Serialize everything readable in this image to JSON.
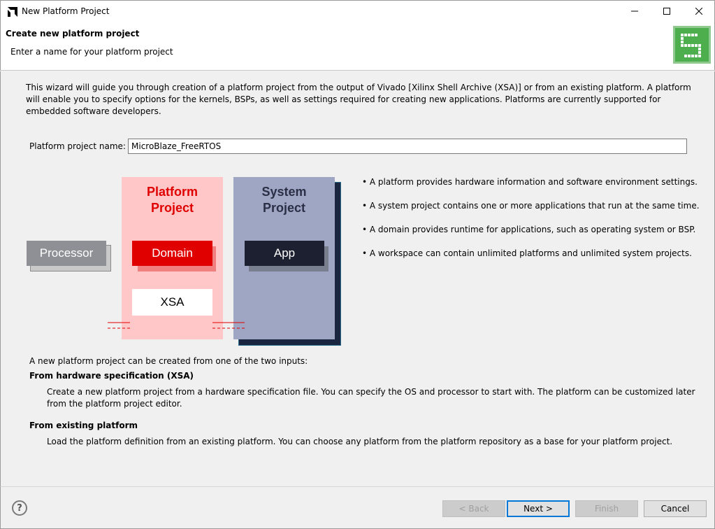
{
  "window": {
    "title": "New Platform Project",
    "icon": "amd-arrow-icon"
  },
  "header": {
    "title": "Create new platform project",
    "subtitle": "Enter a name for your platform project",
    "image_icon": "wizard-banner-icon"
  },
  "intro": "This wizard will guide you through creation of a platform project from the output of Vivado [Xilinx Shell Archive (XSA)] or from an existing platform. A platform will enable you to specify options for the kernels, BSPs, as well as settings required for creating new applications. Platforms are currently supported for embedded software developers.",
  "form": {
    "name_label": "Platform project name:",
    "name_value": "MicroBlaze_FreeRTOS"
  },
  "diagram": {
    "platform_title_1": "Platform",
    "platform_title_2": "Project",
    "system_title_1": "System",
    "system_title_2": "Project",
    "processor": "Processor",
    "domain": "Domain",
    "xsa": "XSA",
    "app": "App",
    "colors": {
      "platform_bg": "#ffc7c7",
      "domain": "#e00000",
      "system_bg": "#9fa6c4",
      "app": "#1d2030",
      "title_red": "#e00000",
      "title_dark": "#2a2f45"
    }
  },
  "bullets": [
    "• A platform provides hardware information and software environment settings.",
    "• A system project contains one or more applications that run at the same time.",
    "• A domain provides runtime for applications, such as operating system or BSP.",
    "• A workspace can contain unlimited platforms and unlimited system projects."
  ],
  "inputs": {
    "intro": "A new platform project can be created from one of the two inputs:",
    "xsa_title": "From hardware specification (XSA)",
    "xsa_desc_1": "Create a new platform project from a hardware specification file. You can specify the OS and processor to start with. The platform can be customized later",
    "xsa_desc_2": "from the platform project editor.",
    "existing_title": "From existing platform",
    "existing_desc": "Load the platform definition from an existing platform. You can choose any platform from the platform repository as a base for your platform project."
  },
  "buttons": {
    "back": "< Back",
    "next": "Next >",
    "finish": "Finish",
    "cancel": "Cancel",
    "help": "?"
  }
}
